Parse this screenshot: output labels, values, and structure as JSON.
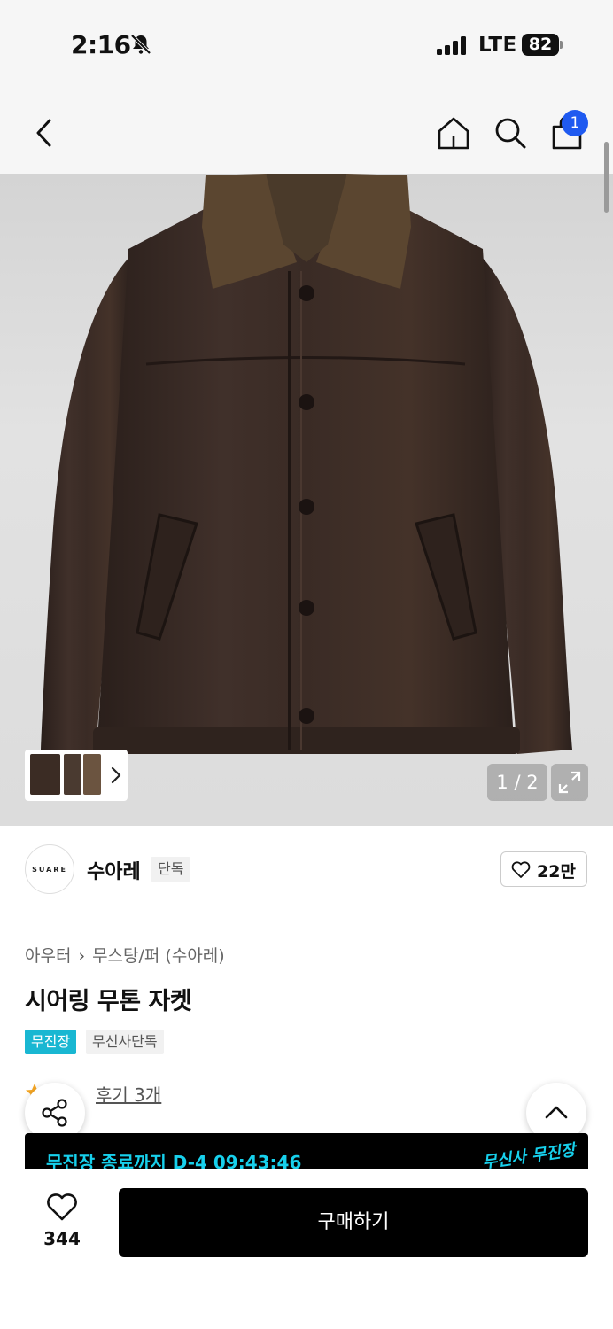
{
  "status_bar": {
    "time": "2:16",
    "network": "LTE",
    "battery": "82"
  },
  "nav": {
    "cart_count": "1"
  },
  "gallery": {
    "page_indicator": "1 / 2",
    "current_page": 1,
    "total_pages": 2
  },
  "brand": {
    "logo_text": "SUARE",
    "name": "수아레",
    "badge": "단독",
    "likes": "22만"
  },
  "breadcrumb": {
    "category": "아우터",
    "separator": "›",
    "subcategory": "무스탕/퍼 (수아레)"
  },
  "product": {
    "title": "시어링 무톤 자켓"
  },
  "tags": {
    "primary": "무진장",
    "secondary": "무신사단독"
  },
  "reviews": {
    "label": "후기 3개"
  },
  "promo": {
    "text": "무진장 종료까지 D-4 09:43:46",
    "logo": "무신사 무진장"
  },
  "bottom_bar": {
    "wish_count": "344",
    "buy_label": "구매하기"
  },
  "colors": {
    "accent": "#19b7d2",
    "cart_badge": "#1f5af0",
    "buy_button": "#000000",
    "promo_text": "#17d0ec"
  },
  "icons": [
    "back-icon",
    "home-icon",
    "search-icon",
    "cart-icon",
    "bell-off-icon",
    "expand-icon",
    "heart-icon",
    "share-icon",
    "chevron-up-icon",
    "star-icon"
  ]
}
